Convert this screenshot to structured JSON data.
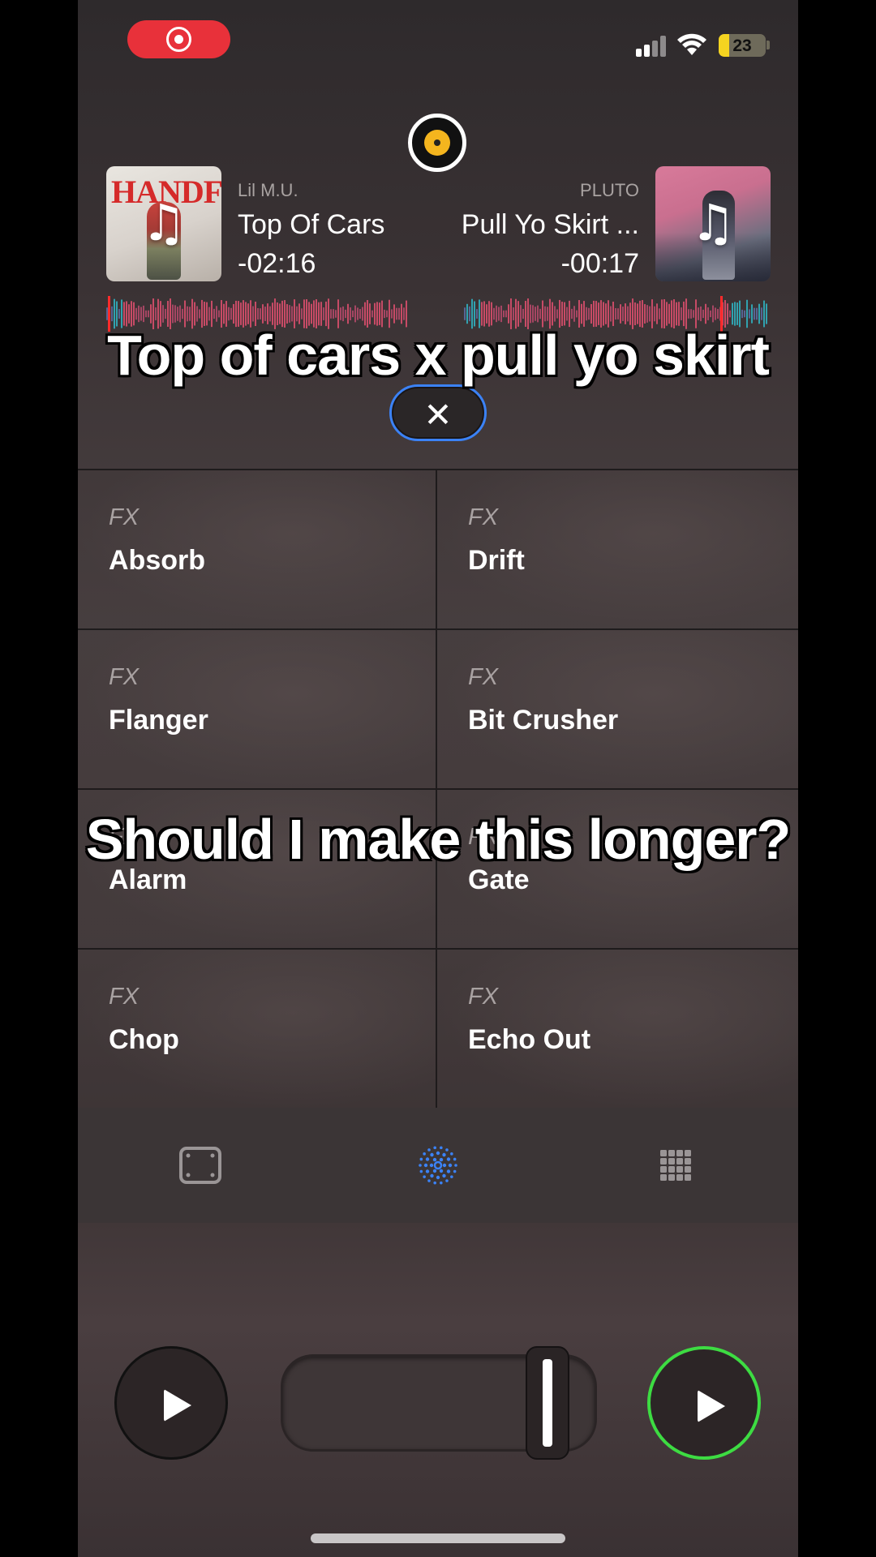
{
  "status_bar": {
    "recording": true,
    "signal_bars": 4,
    "signal_active": 2,
    "battery_percent": "23",
    "battery_color": "#f5d420"
  },
  "deck_left": {
    "cover_text": "HANDFUL",
    "artist": "Lil M.U.",
    "title": "Top Of Cars",
    "time": "-02:16",
    "icon": "music-note-icon"
  },
  "deck_right": {
    "artist": "PLUTO",
    "title": "Pull Yo Skirt ...",
    "time": "-00:17",
    "icon": "music-note-icon"
  },
  "captions": {
    "top": "Top of cars x pull yo skirt",
    "mid": "Should I make this longer?"
  },
  "close_button": {
    "icon": "close-icon",
    "label": "✕"
  },
  "fx": {
    "tag": "FX",
    "items": [
      {
        "label": "Absorb"
      },
      {
        "label": "Drift"
      },
      {
        "label": "Flanger"
      },
      {
        "label": "Bit Crusher"
      },
      {
        "label": "Alarm"
      },
      {
        "label": "Gate"
      },
      {
        "label": "Chop"
      },
      {
        "label": "Echo Out"
      }
    ]
  },
  "tabbar": {
    "tabs": [
      {
        "name": "pads",
        "icon": "pad-icon",
        "active": false
      },
      {
        "name": "fx",
        "icon": "fx-ring-icon",
        "active": true
      },
      {
        "name": "grid",
        "icon": "grid-icon",
        "active": false
      }
    ],
    "active_color": "#3b82f6"
  },
  "transport": {
    "crossfader_position": 0.9,
    "right_deck_playing_color": "#3ddc42"
  },
  "colors": {
    "accent_blue": "#3b82f6",
    "record_red": "#e8313a"
  }
}
